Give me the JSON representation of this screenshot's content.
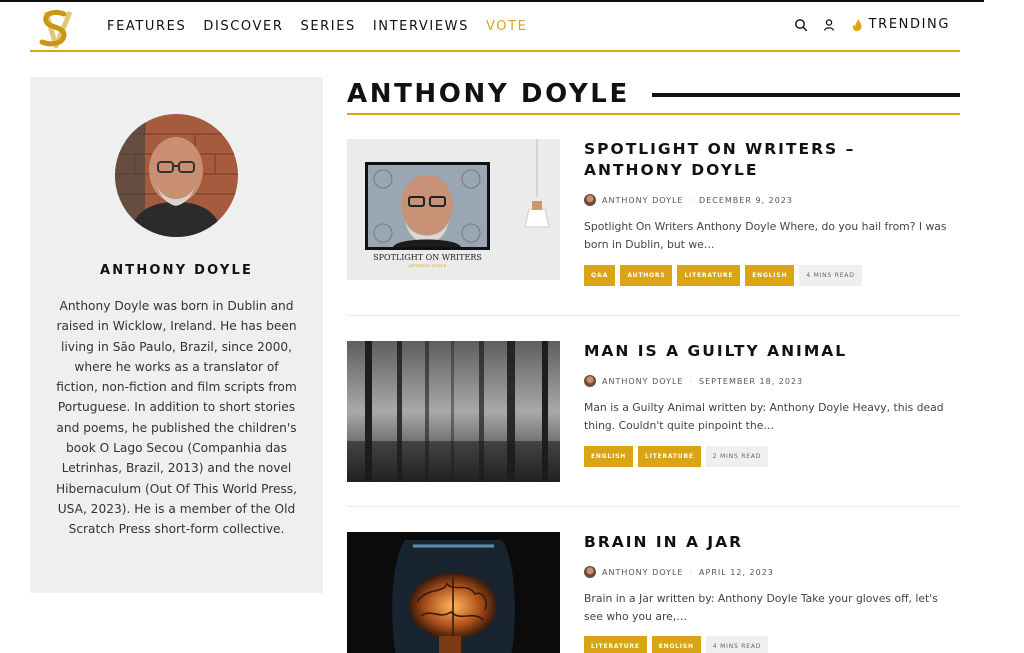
{
  "header": {
    "logo_letters": "SV",
    "nav": [
      {
        "label": "FEATURES",
        "active": false
      },
      {
        "label": "DISCOVER",
        "active": false
      },
      {
        "label": "SERIES",
        "active": false
      },
      {
        "label": "INTERVIEWS",
        "active": false
      },
      {
        "label": "VOTE",
        "active": true
      }
    ],
    "trending_label": "TRENDING"
  },
  "author": {
    "name": "ANTHONY DOYLE",
    "bio": "Anthony Doyle was born in Dublin and raised in Wicklow, Ireland. He has been living in São Paulo, Brazil, since 2000, where he works as a translator of fiction, non-fiction and film scripts from Portuguese. In addition to short stories and poems, he published the children's book O Lago Secou (Companhia das Letrinhas, Brazil, 2013) and the novel Hibernaculum (Out Of This World Press, USA, 2023). He is a member of the Old Scratch Press short-form collective."
  },
  "page_title": "ANTHONY DOYLE",
  "posts": [
    {
      "title": "SPOTLIGHT ON WRITERS – ANTHONY DOYLE",
      "author": "ANTHONY DOYLE",
      "date": "DECEMBER 9, 2023",
      "excerpt": "Spotlight On Writers Anthony Doyle   Where, do you hail from? I was born in Dublin, but we…",
      "tags": [
        "Q&A",
        "AUTHORS",
        "LITERATURE",
        "ENGLISH"
      ],
      "read_time": "4 MINS READ",
      "thumb_caption": "SPOTLIGHT ON WRITERS",
      "thumb_subcaption": "ANTHONY DOYLE"
    },
    {
      "title": "MAN IS A GUILTY ANIMAL",
      "author": "ANTHONY DOYLE",
      "date": "SEPTEMBER 18, 2023",
      "excerpt": "Man is a Guilty Animal written by: Anthony Doyle   Heavy, this dead thing. Couldn't quite pinpoint the…",
      "tags": [
        "ENGLISH",
        "LITERATURE"
      ],
      "read_time": "2 MINS READ"
    },
    {
      "title": "BRAIN IN A JAR",
      "author": "ANTHONY DOYLE",
      "date": "APRIL 12, 2023",
      "excerpt": "Brain in a Jar written by: Anthony Doyle   Take your gloves off, let's see who you are,…",
      "tags": [
        "LITERATURE",
        "ENGLISH"
      ],
      "read_time": "4 MINS READ"
    }
  ],
  "colors": {
    "accent": "#d9a514",
    "box_bg": "#efefef",
    "text": "#111111"
  },
  "icons": {
    "search": "search-icon",
    "user": "user-icon",
    "trending": "flame-icon"
  }
}
